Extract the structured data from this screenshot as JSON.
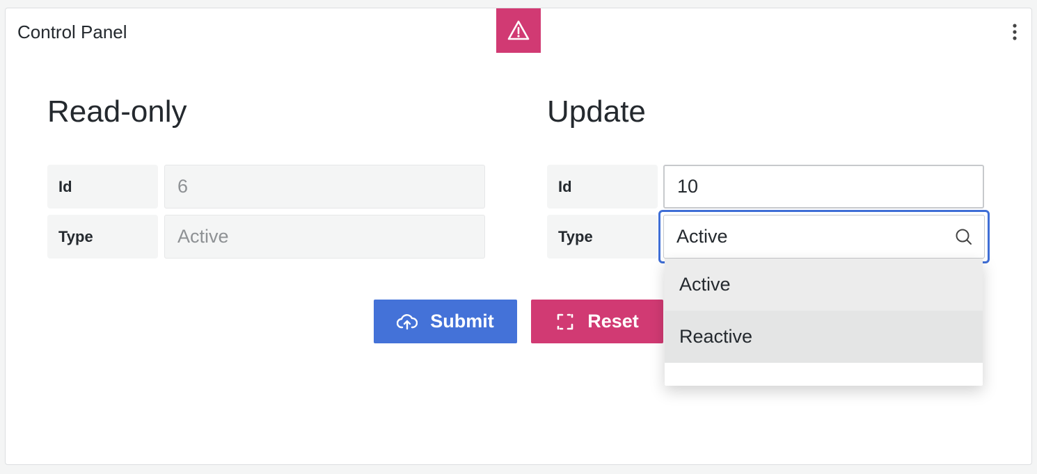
{
  "panel": {
    "title": "Control Panel",
    "alert_icon": "warning-triangle-icon",
    "menu_icon": "vertical-ellipsis-icon",
    "alert_color": "#d13a73"
  },
  "readonly": {
    "title": "Read-only",
    "id_label": "Id",
    "id_value": "6",
    "type_label": "Type",
    "type_value": "Active"
  },
  "update": {
    "title": "Update",
    "id_label": "Id",
    "id_value": "10",
    "type_label": "Type",
    "type_value": "Active",
    "search_icon": "search-icon",
    "focus_color": "#3f6ed6",
    "options": [
      "Active",
      "Reactive"
    ]
  },
  "actions": {
    "submit_label": "Submit",
    "submit_icon": "cloud-upload-icon",
    "submit_color": "#4472d8",
    "reset_label": "Reset",
    "reset_icon": "sync-icon",
    "reset_color": "#d13a73"
  }
}
